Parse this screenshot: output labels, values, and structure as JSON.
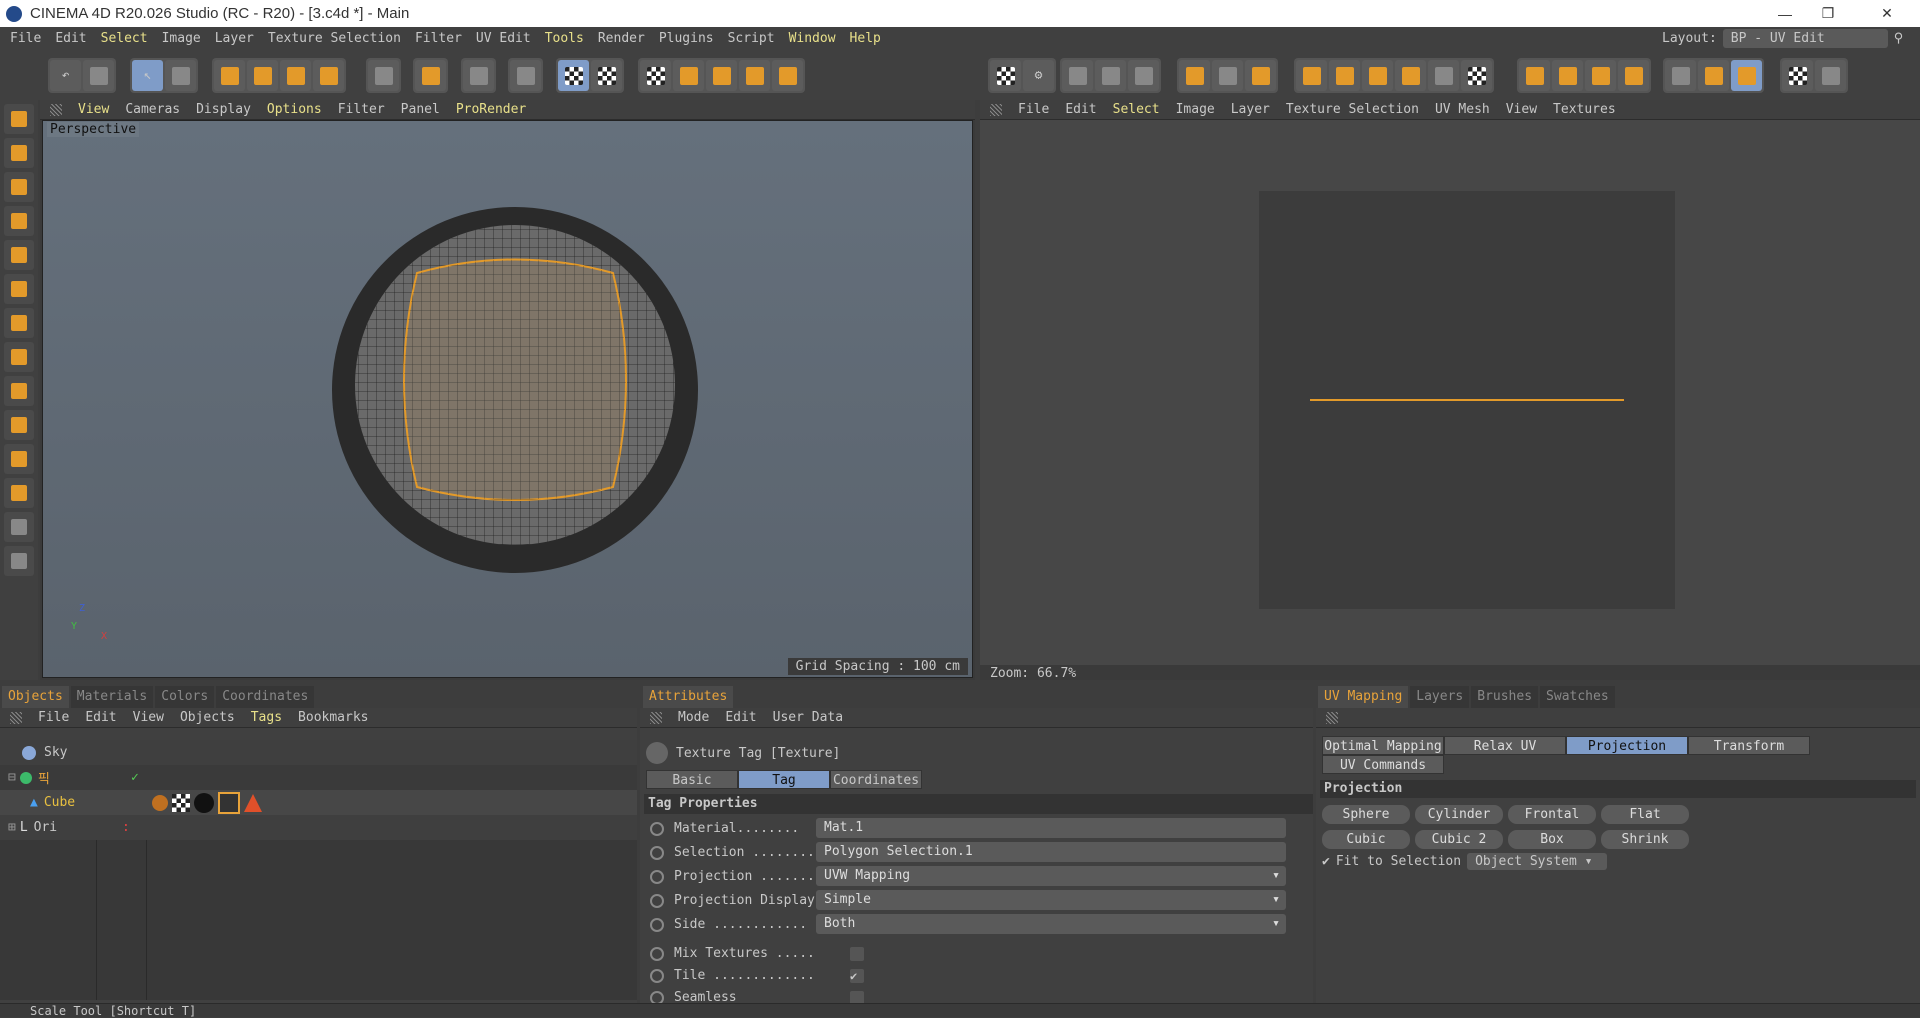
{
  "window": {
    "title": "CINEMA 4D R20.026 Studio (RC - R20) - [3.c4d *] - Main",
    "minimize": "—",
    "maximize": "❐",
    "close": "✕"
  },
  "menu": [
    "File",
    "Edit",
    "Select",
    "Image",
    "Layer",
    "Texture Selection",
    "Filter",
    "UV Edit",
    "Tools",
    "Render",
    "Plugins",
    "Script",
    "Window",
    "Help"
  ],
  "menu_highlight": [
    "Select",
    "Tools",
    "Window",
    "Help"
  ],
  "layout": {
    "label": "Layout:",
    "value": "BP - UV Edit"
  },
  "viewport": {
    "menu": [
      "View",
      "Cameras",
      "Display",
      "Options",
      "Filter",
      "Panel",
      "ProRender"
    ],
    "label": "Perspective",
    "grid_spacing": "Grid Spacing : 100 cm",
    "axes": {
      "z": "Z",
      "y": "Y",
      "x": "X"
    }
  },
  "uv_editor": {
    "menu": [
      "File",
      "Edit",
      "Select",
      "Image",
      "Layer",
      "Texture Selection",
      "UV Mesh",
      "View",
      "Textures"
    ],
    "zoom": "Zoom: 66.7%"
  },
  "objects_panel": {
    "tabs": [
      "Objects",
      "Materials",
      "Colors",
      "Coordinates"
    ],
    "menu": [
      "File",
      "Edit",
      "View",
      "Objects",
      "Tags",
      "Bookmarks"
    ],
    "items": [
      {
        "name": "Sky"
      },
      {
        "name": "픽"
      },
      {
        "name": "Cube"
      },
      {
        "name": "Ori"
      }
    ]
  },
  "attributes": {
    "tab": "Attributes",
    "menu": [
      "Mode",
      "Edit",
      "User Data"
    ],
    "title": "Texture Tag [Texture]",
    "subtabs": [
      "Basic",
      "Tag",
      "Coordinates"
    ],
    "section": "Tag Properties",
    "props": [
      {
        "label": "Material........",
        "value": "Mat.1"
      },
      {
        "label": "Selection ........",
        "value": "Polygon Selection.1"
      },
      {
        "label": "Projection .......",
        "value": "UVW Mapping"
      },
      {
        "label": "Projection Display",
        "value": "Simple"
      },
      {
        "label": "Side ............",
        "value": "Both"
      }
    ],
    "checks": [
      {
        "label": "Mix Textures .....",
        "checked": false
      },
      {
        "label": "Tile .............",
        "checked": true
      },
      {
        "label": "Seamless",
        "checked": false
      }
    ]
  },
  "uv_mapping": {
    "tabs": [
      "UV Mapping",
      "Layers",
      "Brushes",
      "Swatches"
    ],
    "subtabs": [
      "Optimal Mapping",
      "Relax UV",
      "Projection",
      "Transform",
      "UV Commands"
    ],
    "section": "Projection",
    "buttons": [
      "Sphere",
      "Cylinder",
      "Frontal",
      "Flat",
      "Cubic",
      "Cubic 2",
      "Box",
      "Shrink"
    ],
    "fit_label": "Fit to Selection",
    "fit_checked": true,
    "system": "Object System"
  },
  "status": "Scale Tool [Shortcut T]",
  "colors": {
    "accent": "#e8a33a",
    "selected_tab": "#7f9cc8",
    "uv_line": "#e39a2a"
  }
}
